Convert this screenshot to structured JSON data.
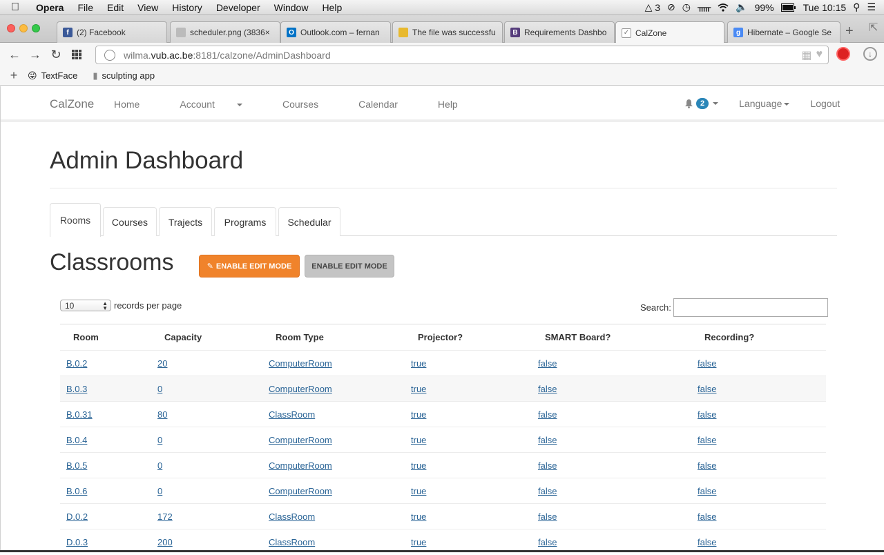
{
  "menubar": {
    "app": "Opera",
    "items": [
      "File",
      "Edit",
      "View",
      "History",
      "Developer",
      "Window",
      "Help"
    ],
    "status": {
      "adobe_count": "3",
      "battery": "99%",
      "clock": "Tue 10:15"
    }
  },
  "browser": {
    "tabs": [
      {
        "label": "(2) Facebook",
        "icon": "facebook-icon",
        "color": "#3b5998",
        "glyph": "f"
      },
      {
        "label": "scheduler.png (3836×",
        "icon": "image-file-icon",
        "color": "#999999",
        "glyph": ""
      },
      {
        "label": "Outlook.com – fernan",
        "icon": "outlook-icon",
        "color": "#0072c6",
        "glyph": "O"
      },
      {
        "label": "The file was successfu",
        "icon": "document-icon",
        "color": "#e8b92e",
        "glyph": ""
      },
      {
        "label": "Requirements Dashbo",
        "icon": "bootstrap-icon",
        "color": "#563d7c",
        "glyph": "B"
      },
      {
        "label": "CalZone",
        "icon": "calzone-icon",
        "color": "#777777",
        "glyph": ""
      },
      {
        "label": "Hibernate – Google Se",
        "icon": "google-icon",
        "color": "#4a8af4",
        "glyph": "g"
      }
    ],
    "active_tab_index": 5,
    "url_prefix": "wilma.",
    "url_host": "vub.ac.be",
    "url_rest": ":8181/calzone/AdminDashboard",
    "bookmarks": [
      {
        "label": "TextFace",
        "icon": "smiley-icon"
      },
      {
        "label": "sculpting app",
        "icon": "page-icon"
      }
    ]
  },
  "nav": {
    "brand": "CalZone",
    "links": [
      {
        "label": "Home",
        "dropdown": false
      },
      {
        "label": "Account",
        "dropdown": true
      },
      {
        "label": "Courses",
        "dropdown": false
      },
      {
        "label": "Calendar",
        "dropdown": false
      },
      {
        "label": "Help",
        "dropdown": false
      }
    ],
    "notification_count": "2",
    "language": "Language",
    "logout": "Logout"
  },
  "page": {
    "title": "Admin Dashboard",
    "tabs": [
      "Rooms",
      "Courses",
      "Trajects",
      "Programs",
      "Schedular"
    ],
    "active_tab": "Rooms",
    "section_title": "Classrooms",
    "edit_button_primary": "ENABLE EDIT MODE",
    "edit_button_secondary": "ENABLE EDIT MODE",
    "records_per_page_value": "10",
    "records_per_page_label": "records per page",
    "search_label": "Search:",
    "search_value": ""
  },
  "table": {
    "headers": [
      "Room",
      "Capacity",
      "Room Type",
      "Projector?",
      "SMART Board?",
      "Recording?"
    ],
    "rows": [
      [
        "B.0.2",
        "20",
        "ComputerRoom",
        "true",
        "false",
        "false"
      ],
      [
        "B.0.3",
        "0",
        "ComputerRoom",
        "true",
        "false",
        "false"
      ],
      [
        "B.0.31",
        "80",
        "ClassRoom",
        "true",
        "false",
        "false"
      ],
      [
        "B.0.4",
        "0",
        "ComputerRoom",
        "true",
        "false",
        "false"
      ],
      [
        "B.0.5",
        "0",
        "ComputerRoom",
        "true",
        "false",
        "false"
      ],
      [
        "B.0.6",
        "0",
        "ComputerRoom",
        "true",
        "false",
        "false"
      ],
      [
        "D.0.2",
        "172",
        "ClassRoom",
        "true",
        "false",
        "false"
      ],
      [
        "D.0.3",
        "200",
        "ClassRoom",
        "true",
        "false",
        "false"
      ]
    ]
  },
  "colors": {
    "accent_orange": "#f0832b",
    "link_blue": "#2a6496",
    "badge_blue": "#2a86b8"
  }
}
